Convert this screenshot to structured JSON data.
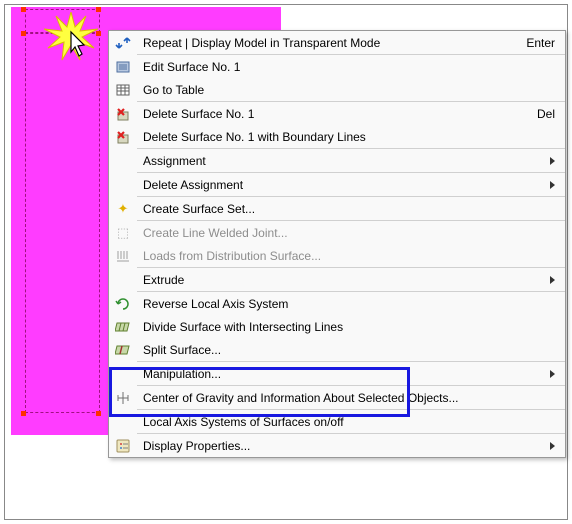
{
  "menu": {
    "repeat": {
      "label": "Repeat | Display Model in Transparent Mode",
      "shortcut": "Enter"
    },
    "editSurface": "Edit Surface No. 1",
    "goToTable": "Go to Table",
    "deleteSurface": {
      "label": "Delete Surface No. 1",
      "shortcut": "Del"
    },
    "deleteSurfaceBoundary": "Delete Surface No. 1 with Boundary Lines",
    "assignment": "Assignment",
    "deleteAssignment": "Delete Assignment",
    "createSet": "Create Surface Set...",
    "createWelded": "Create Line Welded Joint...",
    "loadsDist": "Loads from Distribution Surface...",
    "extrude": "Extrude",
    "reverseAxis": "Reverse Local Axis System",
    "divideSurface": "Divide Surface with Intersecting Lines",
    "splitSurface": "Split Surface...",
    "manipulation": "Manipulation...",
    "centerGravity": "Center of Gravity and Information About Selected Objects...",
    "localAxis": "Local Axis Systems of Surfaces on/off",
    "displayProps": "Display Properties..."
  }
}
